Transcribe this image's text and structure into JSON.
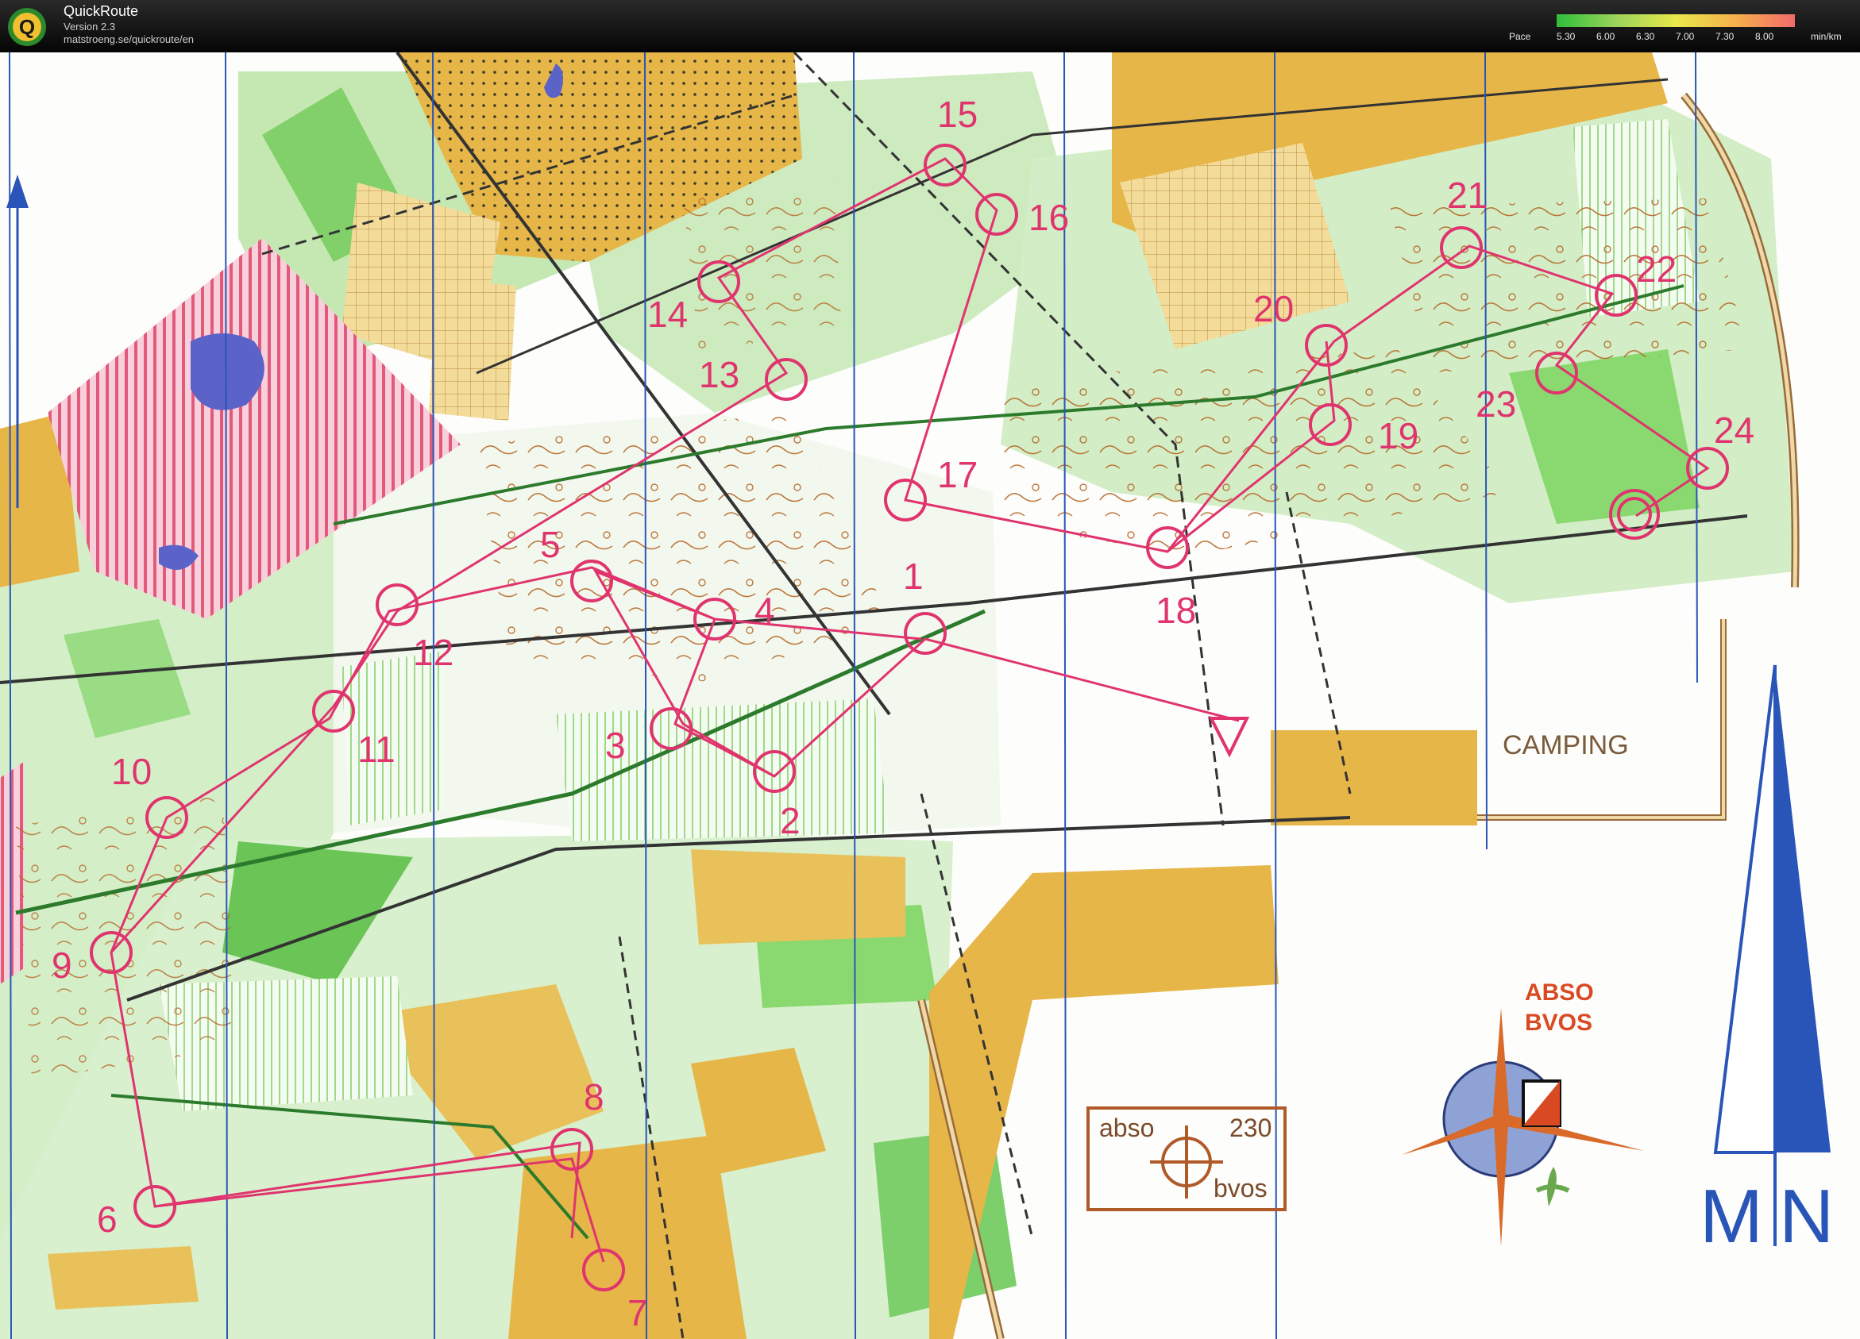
{
  "app": {
    "name": "QuickRoute",
    "version": "Version 2.3",
    "url": "matstroeng.se/quickroute/en",
    "logo_letter": "Q"
  },
  "pace_scale": {
    "label": "Pace",
    "ticks": [
      "5.30",
      "6.00",
      "6.30",
      "7.00",
      "7.30",
      "8.00"
    ],
    "unit": "min/km"
  },
  "map": {
    "camping_label": "CAMPING",
    "club_logo": {
      "line1": "ABSO",
      "line2": "BVOS"
    },
    "info_box": {
      "left": "abso",
      "right": "230",
      "bottom": "bvos"
    },
    "north_arrow": {
      "left": "M",
      "right": "N"
    },
    "controls": [
      "1",
      "2",
      "3",
      "4",
      "5",
      "6",
      "7",
      "8",
      "9",
      "10",
      "11",
      "12",
      "13",
      "14",
      "15",
      "16",
      "17",
      "18",
      "19",
      "20",
      "21",
      "22",
      "23",
      "24"
    ]
  },
  "colors": {
    "course": "#e0346e",
    "meridian": "#2a55b8",
    "open_land": "#e7b648",
    "forest_green": "#7ccf6a",
    "light_green": "#c9ebbd",
    "contour": "#b66a2a",
    "water": "#5b62c8"
  }
}
